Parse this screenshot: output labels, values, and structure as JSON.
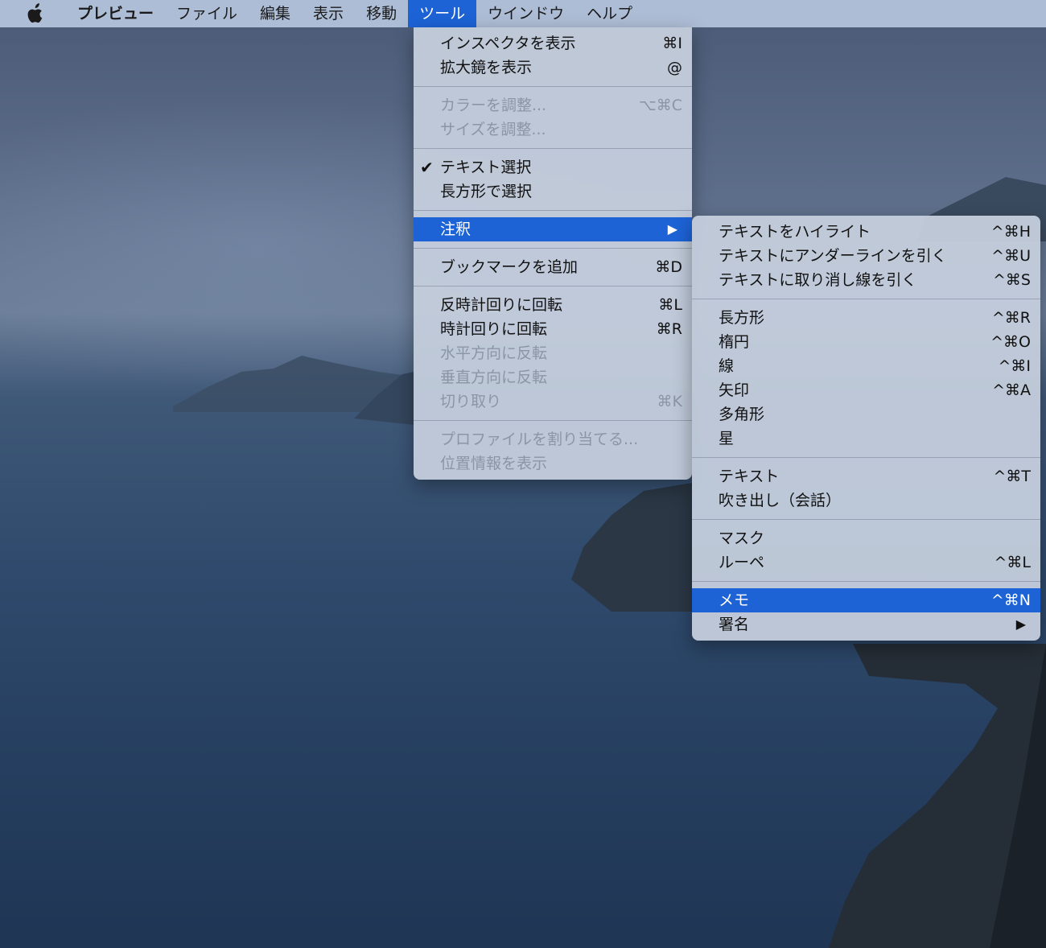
{
  "menubar": {
    "apple_icon": "apple-icon",
    "items": [
      {
        "label": "プレビュー",
        "app": true
      },
      {
        "label": "ファイル"
      },
      {
        "label": "編集"
      },
      {
        "label": "表示"
      },
      {
        "label": "移動"
      },
      {
        "label": "ツール",
        "active": true
      },
      {
        "label": "ウインドウ"
      },
      {
        "label": "ヘルプ"
      }
    ]
  },
  "tools_menu": {
    "groups": [
      [
        {
          "label": "インスペクタを表示",
          "shortcut": "⌘I"
        },
        {
          "label": "拡大鏡を表示",
          "shortcut": "@"
        }
      ],
      [
        {
          "label": "カラーを調整...",
          "shortcut": "⌥⌘C",
          "disabled": true
        },
        {
          "label": "サイズを調整...",
          "disabled": true
        }
      ],
      [
        {
          "label": "テキスト選択",
          "checked": true
        },
        {
          "label": "長方形で選択"
        }
      ],
      [
        {
          "label": "注釈",
          "submenu": true,
          "highlighted": true
        }
      ],
      [
        {
          "label": "ブックマークを追加",
          "shortcut": "⌘D"
        }
      ],
      [
        {
          "label": "反時計回りに回転",
          "shortcut": "⌘L"
        },
        {
          "label": "時計回りに回転",
          "shortcut": "⌘R"
        },
        {
          "label": "水平方向に反転",
          "disabled": true
        },
        {
          "label": "垂直方向に反転",
          "disabled": true
        },
        {
          "label": "切り取り",
          "shortcut": "⌘K",
          "disabled": true
        }
      ],
      [
        {
          "label": "プロファイルを割り当てる...",
          "disabled": true
        },
        {
          "label": "位置情報を表示",
          "disabled": true
        }
      ]
    ]
  },
  "annotate_submenu": {
    "groups": [
      [
        {
          "label": "テキストをハイライト",
          "shortcut": "^⌘H"
        },
        {
          "label": "テキストにアンダーラインを引く",
          "shortcut": "^⌘U"
        },
        {
          "label": "テキストに取り消し線を引く",
          "shortcut": "^⌘S"
        }
      ],
      [
        {
          "label": "長方形",
          "shortcut": "^⌘R"
        },
        {
          "label": "楕円",
          "shortcut": "^⌘O"
        },
        {
          "label": "線",
          "shortcut": "^⌘I"
        },
        {
          "label": "矢印",
          "shortcut": "^⌘A"
        },
        {
          "label": "多角形"
        },
        {
          "label": "星"
        }
      ],
      [
        {
          "label": "テキスト",
          "shortcut": "^⌘T"
        },
        {
          "label": "吹き出し（会話）"
        }
      ],
      [
        {
          "label": "マスク"
        },
        {
          "label": "ルーペ",
          "shortcut": "^⌘L"
        }
      ],
      [
        {
          "label": "メモ",
          "shortcut": "^⌘N",
          "highlighted": true
        },
        {
          "label": "署名",
          "submenu": true
        }
      ]
    ]
  },
  "colors": {
    "highlight": "#1d63d6",
    "menubar": "#b6c6de",
    "menu": "#c4cddc",
    "disabled_text": "#8c95a6"
  }
}
